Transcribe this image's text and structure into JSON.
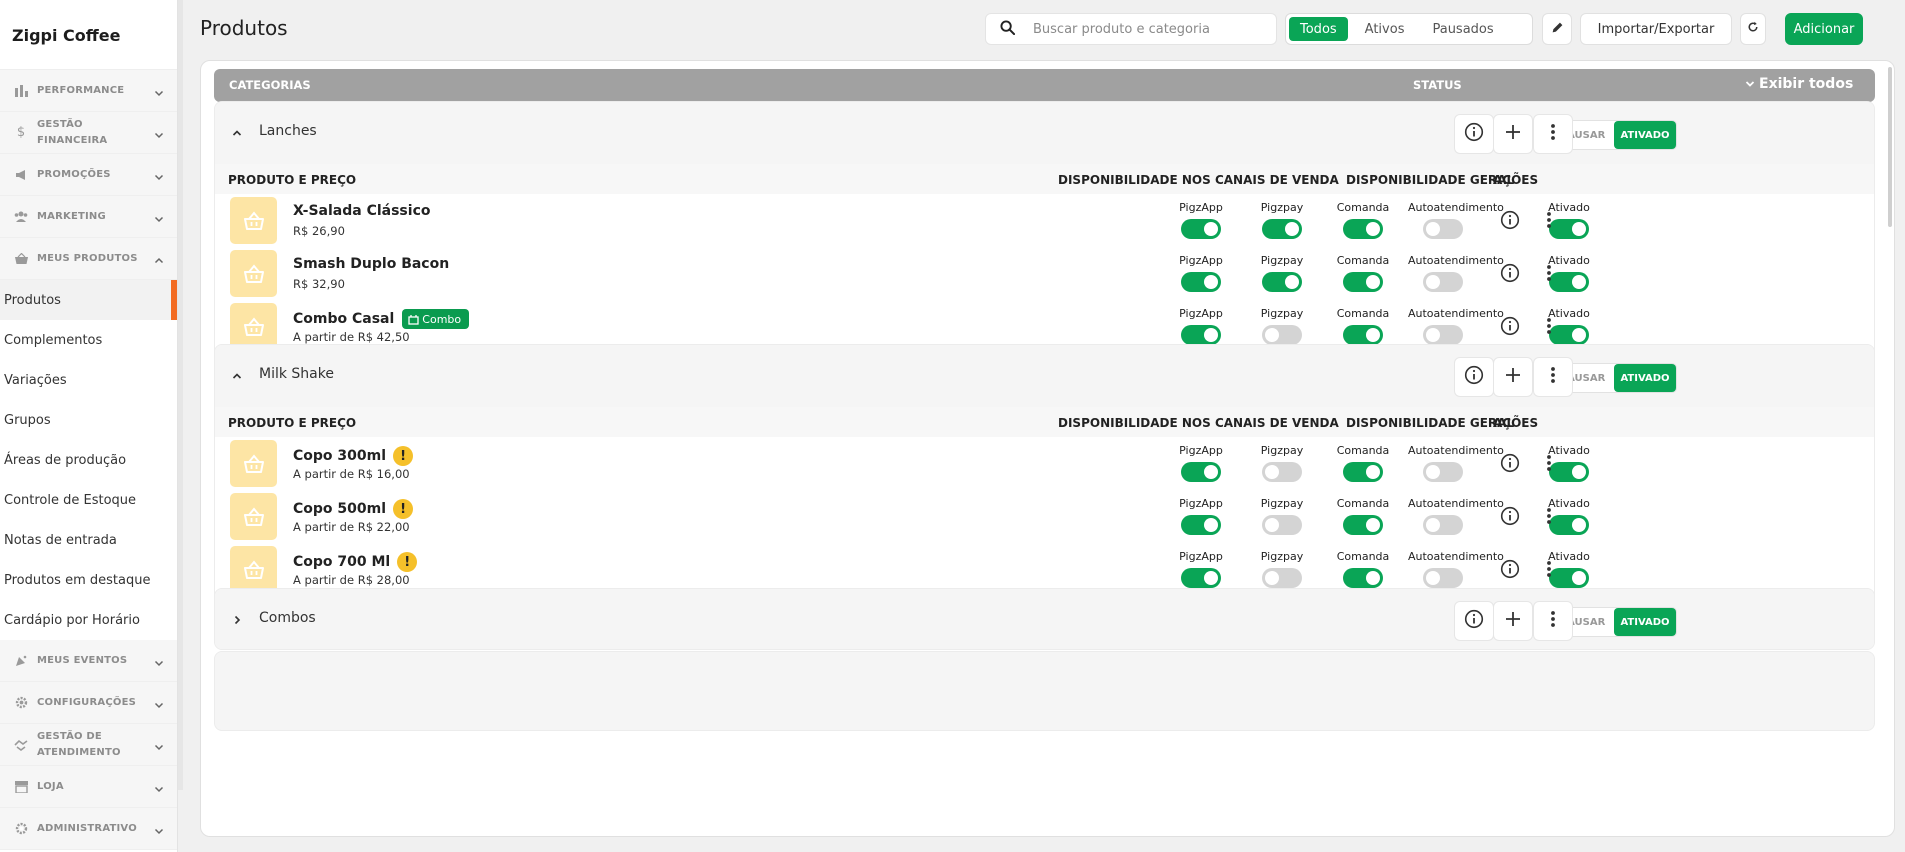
{
  "brand": "Zigpi Coffee",
  "sidebar": {
    "sections_top": [
      {
        "label": "PERFORMANCE",
        "icon": "bar-chart-icon"
      },
      {
        "label": "GESTÃO FINANCEIRA",
        "icon": "dollar-icon"
      },
      {
        "label": "PROMOÇÕES",
        "icon": "megaphone-icon"
      },
      {
        "label": "MARKETING",
        "icon": "users-icon"
      },
      {
        "label": "MEUS PRODUTOS",
        "icon": "basket-icon"
      }
    ],
    "items": [
      {
        "label": "Produtos",
        "active": true
      },
      {
        "label": "Complementos"
      },
      {
        "label": "Variações"
      },
      {
        "label": "Grupos"
      },
      {
        "label": "Áreas de produção"
      },
      {
        "label": "Controle de Estoque"
      },
      {
        "label": "Notas de entrada"
      },
      {
        "label": "Produtos em destaque"
      },
      {
        "label": "Cardápio por Horário"
      }
    ],
    "sections_bottom": [
      {
        "label": "MEUS EVENTOS",
        "icon": "party-icon"
      },
      {
        "label": "CONFIGURAÇÕES",
        "icon": "gear-icon"
      },
      {
        "label": "GESTÃO DE ATENDIMENTO",
        "icon": "handshake-icon"
      },
      {
        "label": "LOJA",
        "icon": "store-icon"
      },
      {
        "label": "ADMINISTRATIVO",
        "icon": "admin-gear-icon"
      }
    ]
  },
  "header": {
    "title": "Produtos",
    "search_placeholder": "Buscar produto e categoria",
    "filters": [
      "Todos",
      "Ativos",
      "Pausados"
    ],
    "active_filter": "Todos",
    "import_export": "Importar/Exportar",
    "add": "Adicionar"
  },
  "table_header": {
    "categories": "CATEGORIAS",
    "status": "STATUS",
    "show_all": "Exibir todos"
  },
  "columns": {
    "product": "PRODUTO E PREÇO",
    "channels": "DISPONIBILIDADE NOS CANAIS DE VENDA",
    "general": "DISPONIBILIDADE GERAL",
    "actions": "AÇÕES"
  },
  "status_labels": {
    "pause": "PAUSAR",
    "active": "ATIVADO"
  },
  "channel_names": [
    "PigzApp",
    "Pigzpay",
    "Comanda",
    "Autoatendimento"
  ],
  "general_label": "Ativado",
  "categories": [
    {
      "name": "Lanches",
      "expanded": true,
      "products": [
        {
          "name": "X-Salada Clássico",
          "price": "R$ 26,90",
          "channels": [
            true,
            true,
            true,
            false
          ],
          "general": true
        },
        {
          "name": "Smash Duplo Bacon",
          "price": "R$ 32,90",
          "channels": [
            true,
            true,
            true,
            false
          ],
          "general": true
        },
        {
          "name": "Combo Casal",
          "price": "A partir de R$ 42,50",
          "badge": "Combo",
          "channels": [
            true,
            false,
            true,
            false
          ],
          "general": true
        }
      ]
    },
    {
      "name": "Milk Shake",
      "expanded": true,
      "products": [
        {
          "name": "Copo 300ml",
          "price": "A partir de R$ 16,00",
          "warning": true,
          "channels": [
            true,
            false,
            true,
            false
          ],
          "general": true
        },
        {
          "name": "Copo 500ml",
          "price": "A partir de R$ 22,00",
          "warning": true,
          "channels": [
            true,
            false,
            true,
            false
          ],
          "general": true
        },
        {
          "name": "Copo 700 Ml",
          "price": "A partir de R$ 28,00",
          "warning": true,
          "channels": [
            true,
            false,
            true,
            false
          ],
          "general": true
        }
      ]
    },
    {
      "name": "Combos",
      "expanded": false,
      "products": []
    }
  ]
}
